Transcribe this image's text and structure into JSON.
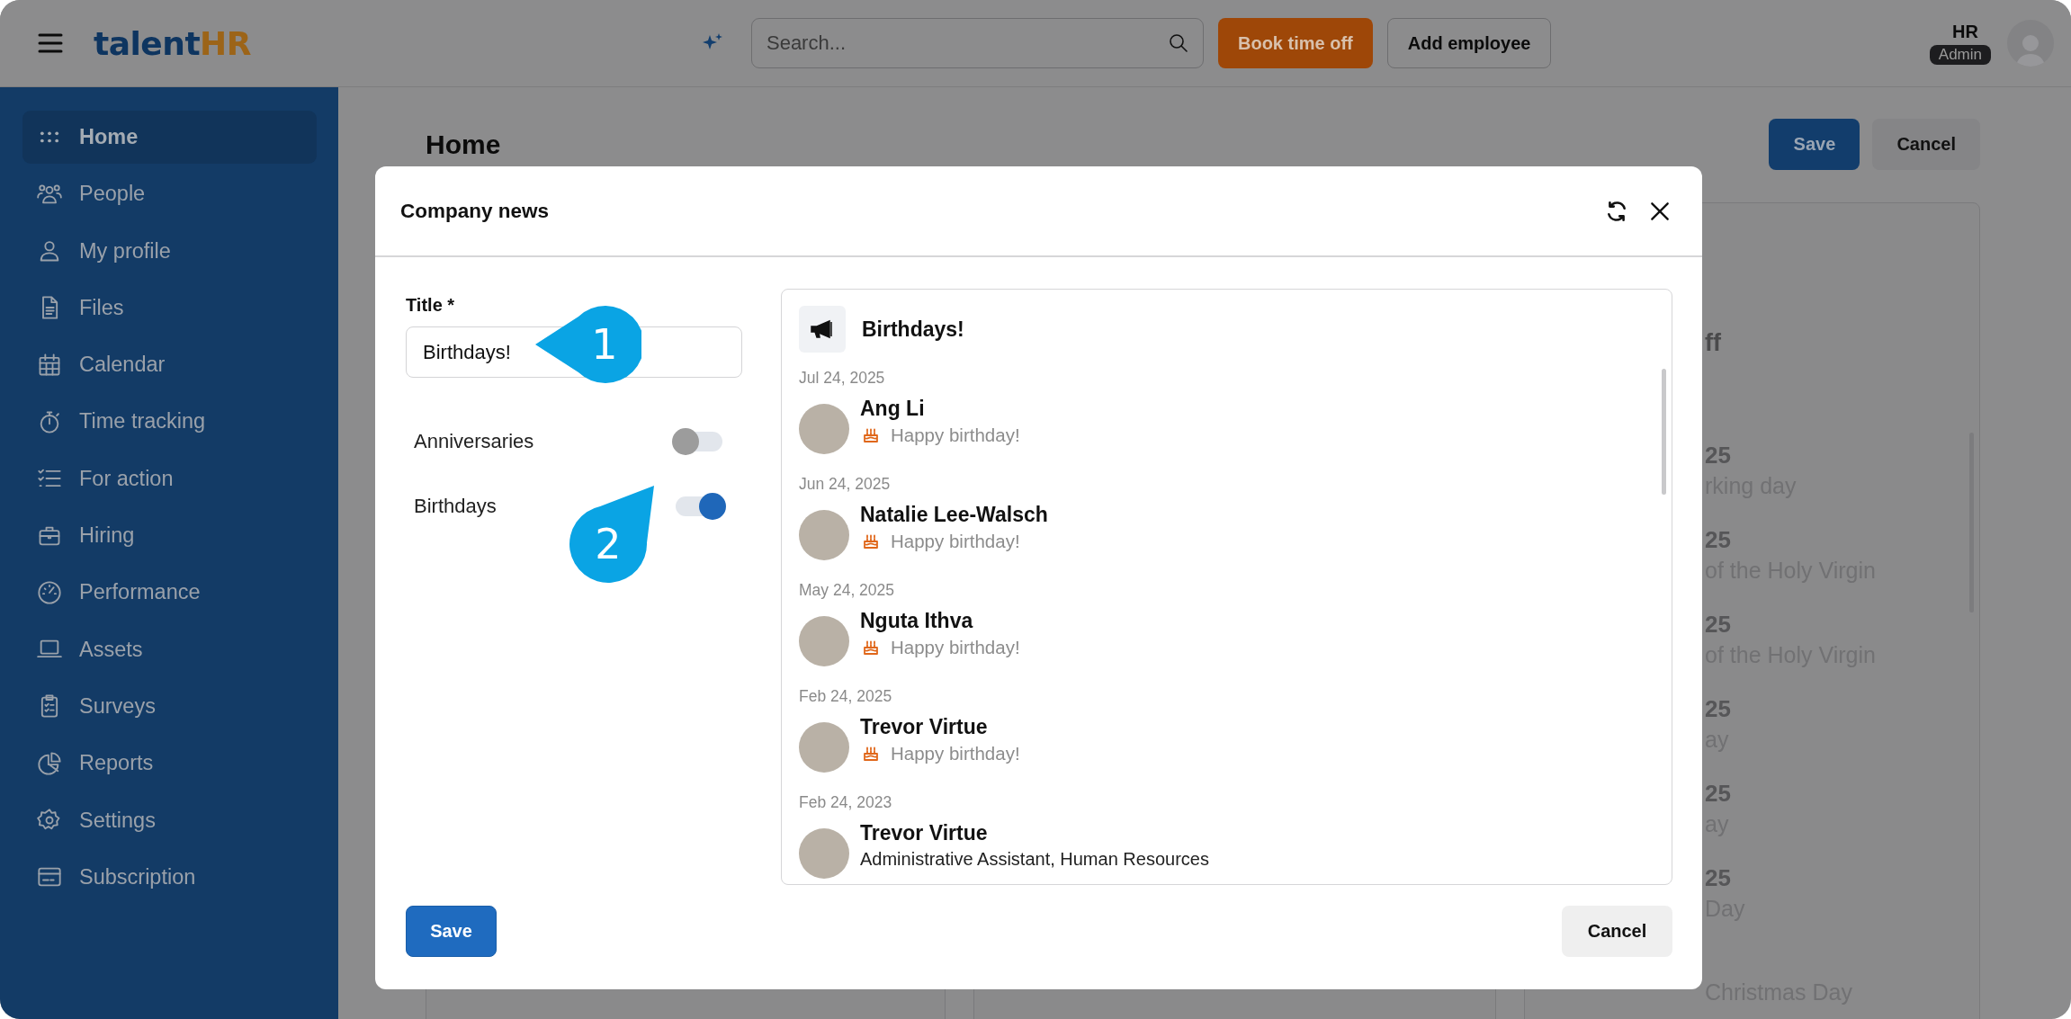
{
  "top_bar": {
    "logo": {
      "text": "talent",
      "accent": "HR"
    },
    "search": {
      "placeholder": "Search..."
    },
    "buttons": [
      {
        "label": "Book time off",
        "kind": "primary"
      },
      {
        "label": "Add employee",
        "kind": "secondary"
      }
    ],
    "user": {
      "name": "HR",
      "role": "Admin"
    }
  },
  "sidebar": {
    "items": [
      {
        "label": "Home",
        "selected": true
      },
      {
        "label": "People",
        "selected": false
      },
      {
        "label": "My profile",
        "selected": false
      },
      {
        "label": "Files",
        "selected": false
      },
      {
        "label": "Calendar",
        "selected": false
      },
      {
        "label": "Time tracking",
        "selected": false
      },
      {
        "label": "For action",
        "selected": false
      },
      {
        "label": "Hiring",
        "selected": false
      },
      {
        "label": "Performance",
        "selected": false
      },
      {
        "label": "Assets",
        "selected": false
      },
      {
        "label": "Surveys",
        "selected": false
      },
      {
        "label": "Reports",
        "selected": false
      },
      {
        "label": "Settings",
        "selected": false
      },
      {
        "label": "Subscription",
        "selected": false
      }
    ]
  },
  "main": {
    "title": "Home",
    "buttons": [
      {
        "label": "Save",
        "kind": "primary"
      },
      {
        "label": "Cancel",
        "kind": "secondary"
      }
    ],
    "side_card": {
      "heading": "ff",
      "events": [
        {
          "date": "25",
          "name": "rking day"
        },
        {
          "date": "25",
          "name": "of the Holy Virgin"
        },
        {
          "date": "25",
          "name": "of the Holy Virgin"
        },
        {
          "date": "25",
          "name": "ay"
        },
        {
          "date": "25",
          "name": "ay"
        },
        {
          "date": "25",
          "name": "Day"
        },
        {
          "name": "Christmas Day"
        }
      ]
    }
  },
  "modal": {
    "title": "Company news",
    "form": {
      "title_label": "Title *",
      "title_value": "Birthdays!",
      "toggles": [
        {
          "label": "Anniversaries",
          "on": false
        },
        {
          "label": "Birthdays",
          "on": true
        }
      ]
    },
    "preview": {
      "title": "Birthdays!",
      "items": [
        {
          "date": "Jul 24, 2025",
          "name": "Ang Li",
          "note": "Happy birthday!"
        },
        {
          "date": "Jun 24, 2025",
          "name": "Natalie Lee-Walsch",
          "note": "Happy birthday!"
        },
        {
          "date": "May 24, 2025",
          "name": "Nguta Ithva",
          "note": "Happy birthday!"
        },
        {
          "date": "Feb 24, 2025",
          "name": "Trevor Virtue",
          "note": "Happy birthday!"
        },
        {
          "date": "Feb 24, 2023",
          "name": "Trevor Virtue",
          "role": "Administrative Assistant, Human Resources"
        }
      ]
    },
    "buttons": [
      {
        "label": "Save",
        "kind": "primary"
      },
      {
        "label": "Cancel",
        "kind": "secondary"
      }
    ]
  },
  "callouts": [
    {
      "number": "1",
      "kind": "left"
    },
    {
      "number": "2",
      "kind": "up_right"
    }
  ]
}
